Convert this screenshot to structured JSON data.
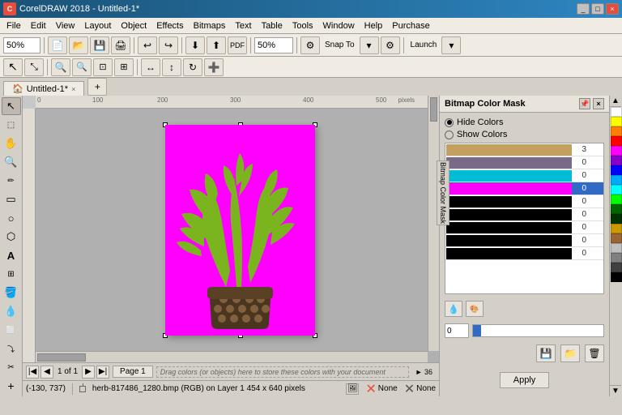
{
  "titleBar": {
    "title": "CorelDRAW 2018 - Untitled-1*",
    "icon": "C",
    "controls": [
      "_",
      "□",
      "×"
    ]
  },
  "menuBar": {
    "items": [
      "File",
      "Edit",
      "View",
      "Layout",
      "Object",
      "Effects",
      "Bitmaps",
      "Text",
      "Table",
      "Tools",
      "Window",
      "Help",
      "Purchase"
    ]
  },
  "toolbar1": {
    "zoom_label": "50%",
    "pdf_label": "PDF",
    "zoom2_label": "50%",
    "snap_label": "Snap To",
    "launch_label": "Launch"
  },
  "tabBar": {
    "tabs": [
      {
        "label": "Untitled-1*",
        "active": true
      }
    ]
  },
  "bitmapPanel": {
    "title": "Bitmap Color Mask",
    "hideColors": "Hide Colors",
    "showColors": "Show Colors",
    "colors": [
      {
        "swatch": "#c4a060",
        "num": "3",
        "selected": false
      },
      {
        "swatch": "#7a6a8a",
        "num": "0",
        "selected": false
      },
      {
        "swatch": "#00bcd4",
        "num": "0",
        "selected": false
      },
      {
        "swatch": "#ff00ff",
        "num": "0",
        "selected": true
      },
      {
        "swatch": "#000000",
        "num": "0",
        "selected": false
      },
      {
        "swatch": "#000000",
        "num": "0",
        "selected": false
      },
      {
        "swatch": "#000000",
        "num": "0",
        "selected": false
      },
      {
        "swatch": "#000000",
        "num": "0",
        "selected": false
      },
      {
        "swatch": "#000000",
        "num": "0",
        "selected": false
      }
    ],
    "sliderValue": "0",
    "applyBtn": "Apply"
  },
  "verticalTabs": [
    "Bitmap Color Mask"
  ],
  "colorPalette": [
    "#ffffff",
    "#ff0000",
    "#ff8000",
    "#ffff00",
    "#00ff00",
    "#00ffff",
    "#0000ff",
    "#ff00ff",
    "#800000",
    "#008000",
    "#000080",
    "#800080",
    "#808000",
    "#008080",
    "#c0c0c0",
    "#808080",
    "#000000",
    "#ff6666",
    "#66ff66",
    "#6666ff",
    "#ffcc00",
    "#cc6600",
    "#336699",
    "#996633",
    "#669966"
  ],
  "statusBar": {
    "coords": "(-130, 737)",
    "filename": "herb-817486_1280.bmp (RGB) on Layer 1 454 x 640 pixels",
    "colorLeft": "None",
    "colorRight": "None"
  },
  "bottomNav": {
    "pageInfo": "1 of 1",
    "pageLabel": "Page 1",
    "dragColorsHint": "Drag colors (or objects) here to store these colors with your document"
  },
  "canvasZoom": "50%"
}
